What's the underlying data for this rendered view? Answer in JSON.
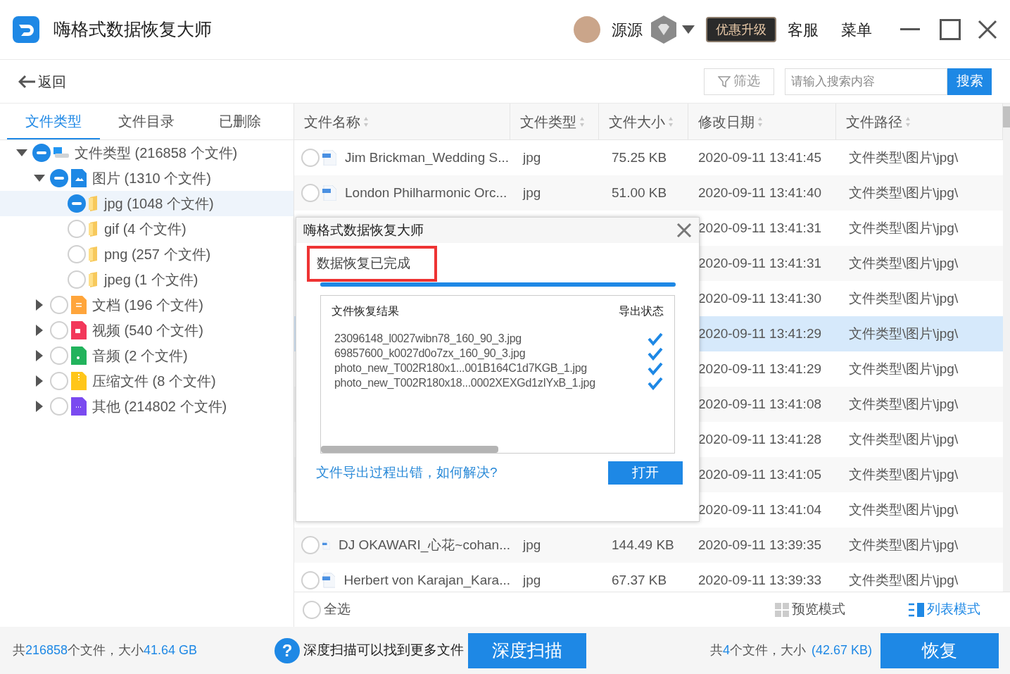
{
  "app": {
    "title": "嗨格式数据恢复大师",
    "user_name": "源源",
    "upgrade": "优惠升级",
    "service": "客服",
    "menu": "菜单"
  },
  "toolbar": {
    "back": "返回",
    "filter": "筛选",
    "search_placeholder": "请输入搜索内容",
    "search_button": "搜索"
  },
  "left_tabs": [
    {
      "label": "文件类型",
      "selected": true
    },
    {
      "label": "文件目录",
      "selected": false
    },
    {
      "label": "已删除",
      "selected": false
    }
  ],
  "tree": [
    {
      "label": "文件类型 (216858 个文件)",
      "kind": "drive",
      "partial": true,
      "expanded": true,
      "selected": false,
      "children": [
        {
          "label": "图片 (1310 个文件)",
          "kind": "image",
          "partial": true,
          "expanded": true,
          "selected": false,
          "children": [
            {
              "label": "jpg (1048 个文件)",
              "kind": "folder",
              "partial": true,
              "selected": true
            },
            {
              "label": "gif (4 个文件)",
              "kind": "folder",
              "partial": false,
              "selected": false
            },
            {
              "label": "png (257 个文件)",
              "kind": "folder",
              "partial": false,
              "selected": false
            },
            {
              "label": "jpeg (1 个文件)",
              "kind": "folder",
              "partial": false,
              "selected": false
            }
          ]
        },
        {
          "label": "文档 (196 个文件)",
          "kind": "document",
          "partial": false,
          "expanded": false,
          "selected": false
        },
        {
          "label": "视频 (540 个文件)",
          "kind": "video",
          "partial": false,
          "expanded": false,
          "selected": false
        },
        {
          "label": "音频 (2 个文件)",
          "kind": "audio",
          "partial": false,
          "expanded": false,
          "selected": false
        },
        {
          "label": "压缩文件 (8 个文件)",
          "kind": "archive",
          "partial": false,
          "expanded": false,
          "selected": false
        },
        {
          "label": "其他 (214802 个文件)",
          "kind": "other",
          "partial": false,
          "expanded": false,
          "selected": false
        }
      ]
    }
  ],
  "table": {
    "columns": [
      "文件名称",
      "文件类型",
      "文件大小",
      "修改日期",
      "文件路径"
    ],
    "rows": [
      {
        "name": "Jim Brickman_Wedding S...",
        "type": "jpg",
        "size": "75.25 KB",
        "date": "2020-09-11 13:41:45",
        "path": "文件类型\\图片\\jpg\\",
        "checked": false,
        "selected": false
      },
      {
        "name": "London Philharmonic Orc...",
        "type": "jpg",
        "size": "51.00 KB",
        "date": "2020-09-11 13:41:40",
        "path": "文件类型\\图片\\jpg\\",
        "checked": false,
        "selected": false
      },
      {
        "date": "2020-09-11 13:41:31",
        "path": "文件类型\\图片\\jpg\\",
        "selected": false
      },
      {
        "date": "2020-09-11 13:41:31",
        "path": "文件类型\\图片\\jpg\\",
        "selected": false
      },
      {
        "date": "2020-09-11 13:41:30",
        "path": "文件类型\\图片\\jpg\\",
        "selected": false
      },
      {
        "date": "2020-09-11 13:41:29",
        "path": "文件类型\\图片\\jpg\\",
        "selected": true
      },
      {
        "date": "2020-09-11 13:41:29",
        "path": "文件类型\\图片\\jpg\\",
        "selected": false
      },
      {
        "date": "2020-09-11 13:41:08",
        "path": "文件类型\\图片\\jpg\\",
        "selected": false
      },
      {
        "date": "2020-09-11 13:41:28",
        "path": "文件类型\\图片\\jpg\\",
        "selected": false
      },
      {
        "date": "2020-09-11 13:41:05",
        "path": "文件类型\\图片\\jpg\\",
        "selected": false
      },
      {
        "date": "2020-09-11 13:41:04",
        "path": "文件类型\\图片\\jpg\\",
        "selected": false
      },
      {
        "name": "DJ OKAWARI_心花~cohan...",
        "type": "jpg",
        "size": "144.49 KB",
        "date": "2020-09-11 13:39:35",
        "path": "文件类型\\图片\\jpg\\",
        "checked": false,
        "selected": false
      },
      {
        "name": "Herbert von Karajan_Kara...",
        "type": "jpg",
        "size": "67.37 KB",
        "date": "2020-09-11 13:39:33",
        "path": "文件类型\\图片\\jpg\\",
        "checked": false,
        "selected": false
      }
    ]
  },
  "footer": {
    "select_all": "全选",
    "select_all_checked": false,
    "modes": [
      {
        "label": "预览模式",
        "kind": "grid",
        "selected": false
      },
      {
        "label": "列表模式",
        "kind": "list",
        "selected": true
      }
    ]
  },
  "status_bar": {
    "help_icon": "?",
    "total_prefix": "共",
    "total_count": "216858",
    "total_mid": "个文件，大小",
    "total_size": "41.64 GB",
    "hint": "深度扫描可以找到更多文件",
    "deep_scan": "深度扫描",
    "selected_prefix": "共",
    "selected_count": "4",
    "selected_mid": "个文件，大小",
    "selected_size": "(42.67 KB)",
    "recover": "恢复"
  },
  "dialog": {
    "title": "嗨格式数据恢复大师",
    "status": "数据恢复已完成",
    "level": 1,
    "result_header": "文件恢复结果",
    "export_header": "导出状态",
    "files": [
      {
        "name": "23096148_l0027wibn78_160_90_3.jpg",
        "done": true
      },
      {
        "name": "69857600_k0027d0o7zx_160_90_3.jpg",
        "done": true
      },
      {
        "name": "photo_new_T002R180x1...001B164C1d7KGB_1.jpg",
        "done": true
      },
      {
        "name": "photo_new_T002R180x18...0002XEXGd1zIYxB_1.jpg",
        "done": true
      }
    ],
    "help_link": "文件导出过程出错，如何解决?",
    "open_button": "打开"
  }
}
